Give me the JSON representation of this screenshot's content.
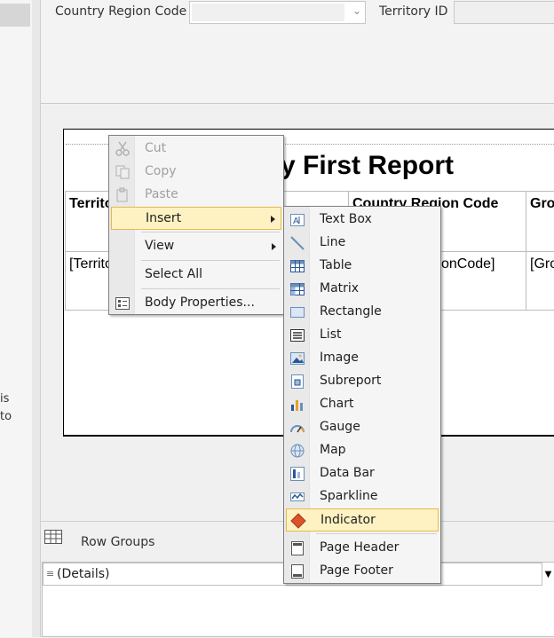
{
  "parameters": {
    "country_region_code_label": "Country Region Code",
    "country_region_code_value": "",
    "territory_id_label": "Territory ID",
    "territory_id_value": ""
  },
  "left_panel": {
    "text_lines": [
      "is",
      "to"
    ]
  },
  "report": {
    "title": "y First Report",
    "table": {
      "headers": [
        "Territo",
        "Country Region Code",
        "Gro"
      ],
      "row": [
        "[Territo",
        "onCode]",
        "[Gro"
      ]
    }
  },
  "row_groups": {
    "label": "Row Groups",
    "details": "(Details)"
  },
  "context_menu": {
    "items": [
      {
        "label": "Cut",
        "icon": "scissors-icon",
        "enabled": false
      },
      {
        "label": "Copy",
        "icon": "copy-icon",
        "enabled": false
      },
      {
        "label": "Paste",
        "icon": "paste-icon",
        "enabled": false
      },
      {
        "label": "Insert",
        "icon": "",
        "enabled": true,
        "submenu": true,
        "highlighted": true
      },
      {
        "label": "View",
        "icon": "",
        "enabled": true,
        "submenu": true
      },
      {
        "label": "Select All",
        "icon": "",
        "enabled": true
      },
      {
        "label": "Body Properties...",
        "icon": "properties-icon",
        "enabled": true
      }
    ]
  },
  "insert_submenu": {
    "items": [
      {
        "label": "Text Box",
        "icon": "textbox-icon"
      },
      {
        "label": "Line",
        "icon": "line-icon"
      },
      {
        "label": "Table",
        "icon": "table-icon"
      },
      {
        "label": "Matrix",
        "icon": "matrix-icon"
      },
      {
        "label": "Rectangle",
        "icon": "rectangle-icon"
      },
      {
        "label": "List",
        "icon": "list-icon"
      },
      {
        "label": "Image",
        "icon": "image-icon"
      },
      {
        "label": "Subreport",
        "icon": "subreport-icon"
      },
      {
        "label": "Chart",
        "icon": "chart-icon"
      },
      {
        "label": "Gauge",
        "icon": "gauge-icon"
      },
      {
        "label": "Map",
        "icon": "map-icon"
      },
      {
        "label": "Data Bar",
        "icon": "databar-icon"
      },
      {
        "label": "Sparkline",
        "icon": "sparkline-icon"
      },
      {
        "label": "Indicator",
        "icon": "indicator-icon",
        "highlighted": true
      },
      {
        "label": "Page Header",
        "icon": "page-header-icon"
      },
      {
        "label": "Page Footer",
        "icon": "page-footer-icon"
      }
    ]
  }
}
